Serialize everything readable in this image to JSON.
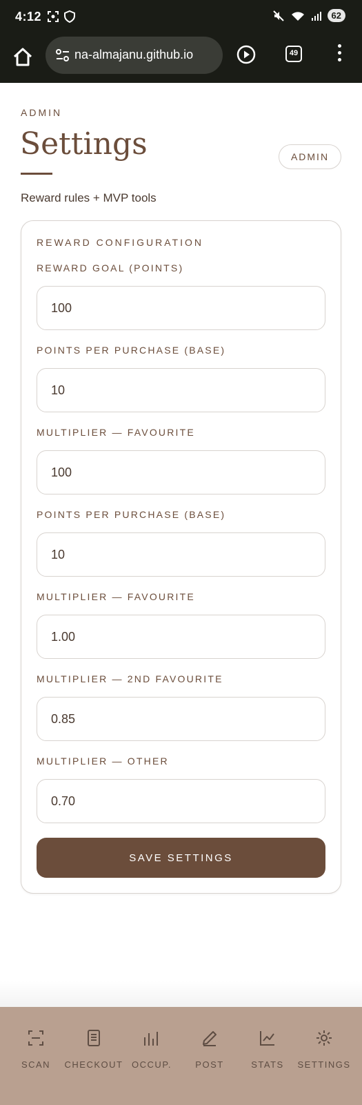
{
  "status_bar": {
    "time": "4:12",
    "battery": "62"
  },
  "browser": {
    "url": "na-almajanu.github.io",
    "tab_count": "49"
  },
  "header": {
    "eyebrow": "ADMIN",
    "title": "Settings",
    "badge": "ADMIN",
    "subtitle": "Reward rules + MVP tools"
  },
  "card": {
    "title": "REWARD CONFIGURATION",
    "fields": [
      {
        "label": "REWARD GOAL (POINTS)",
        "value": "100"
      },
      {
        "label": "POINTS PER PURCHASE (BASE)",
        "value": "10"
      },
      {
        "label": "MULTIPLIER — FAVOURITE",
        "value": "100"
      },
      {
        "label": "POINTS PER PURCHASE (BASE)",
        "value": "10"
      },
      {
        "label": "MULTIPLIER — FAVOURITE",
        "value": "1.00"
      },
      {
        "label": "MULTIPLIER — 2ND FAVOURITE",
        "value": "0.85"
      },
      {
        "label": "MULTIPLIER — OTHER",
        "value": "0.70"
      }
    ],
    "save_label": "SAVE SETTINGS"
  },
  "nav": {
    "items": [
      {
        "label": "SCAN",
        "icon": "scan-icon"
      },
      {
        "label": "CHECKOUT",
        "icon": "receipt-icon"
      },
      {
        "label": "OCCUP.",
        "icon": "bar-chart-icon"
      },
      {
        "label": "POST",
        "icon": "pencil-icon"
      },
      {
        "label": "STATS",
        "icon": "line-chart-icon"
      },
      {
        "label": "SETTINGS",
        "icon": "gear-icon"
      }
    ]
  },
  "colors": {
    "brand_brown": "#6b4d3b",
    "nav_background": "#b9a090",
    "system_bar": "#1a1c16"
  }
}
